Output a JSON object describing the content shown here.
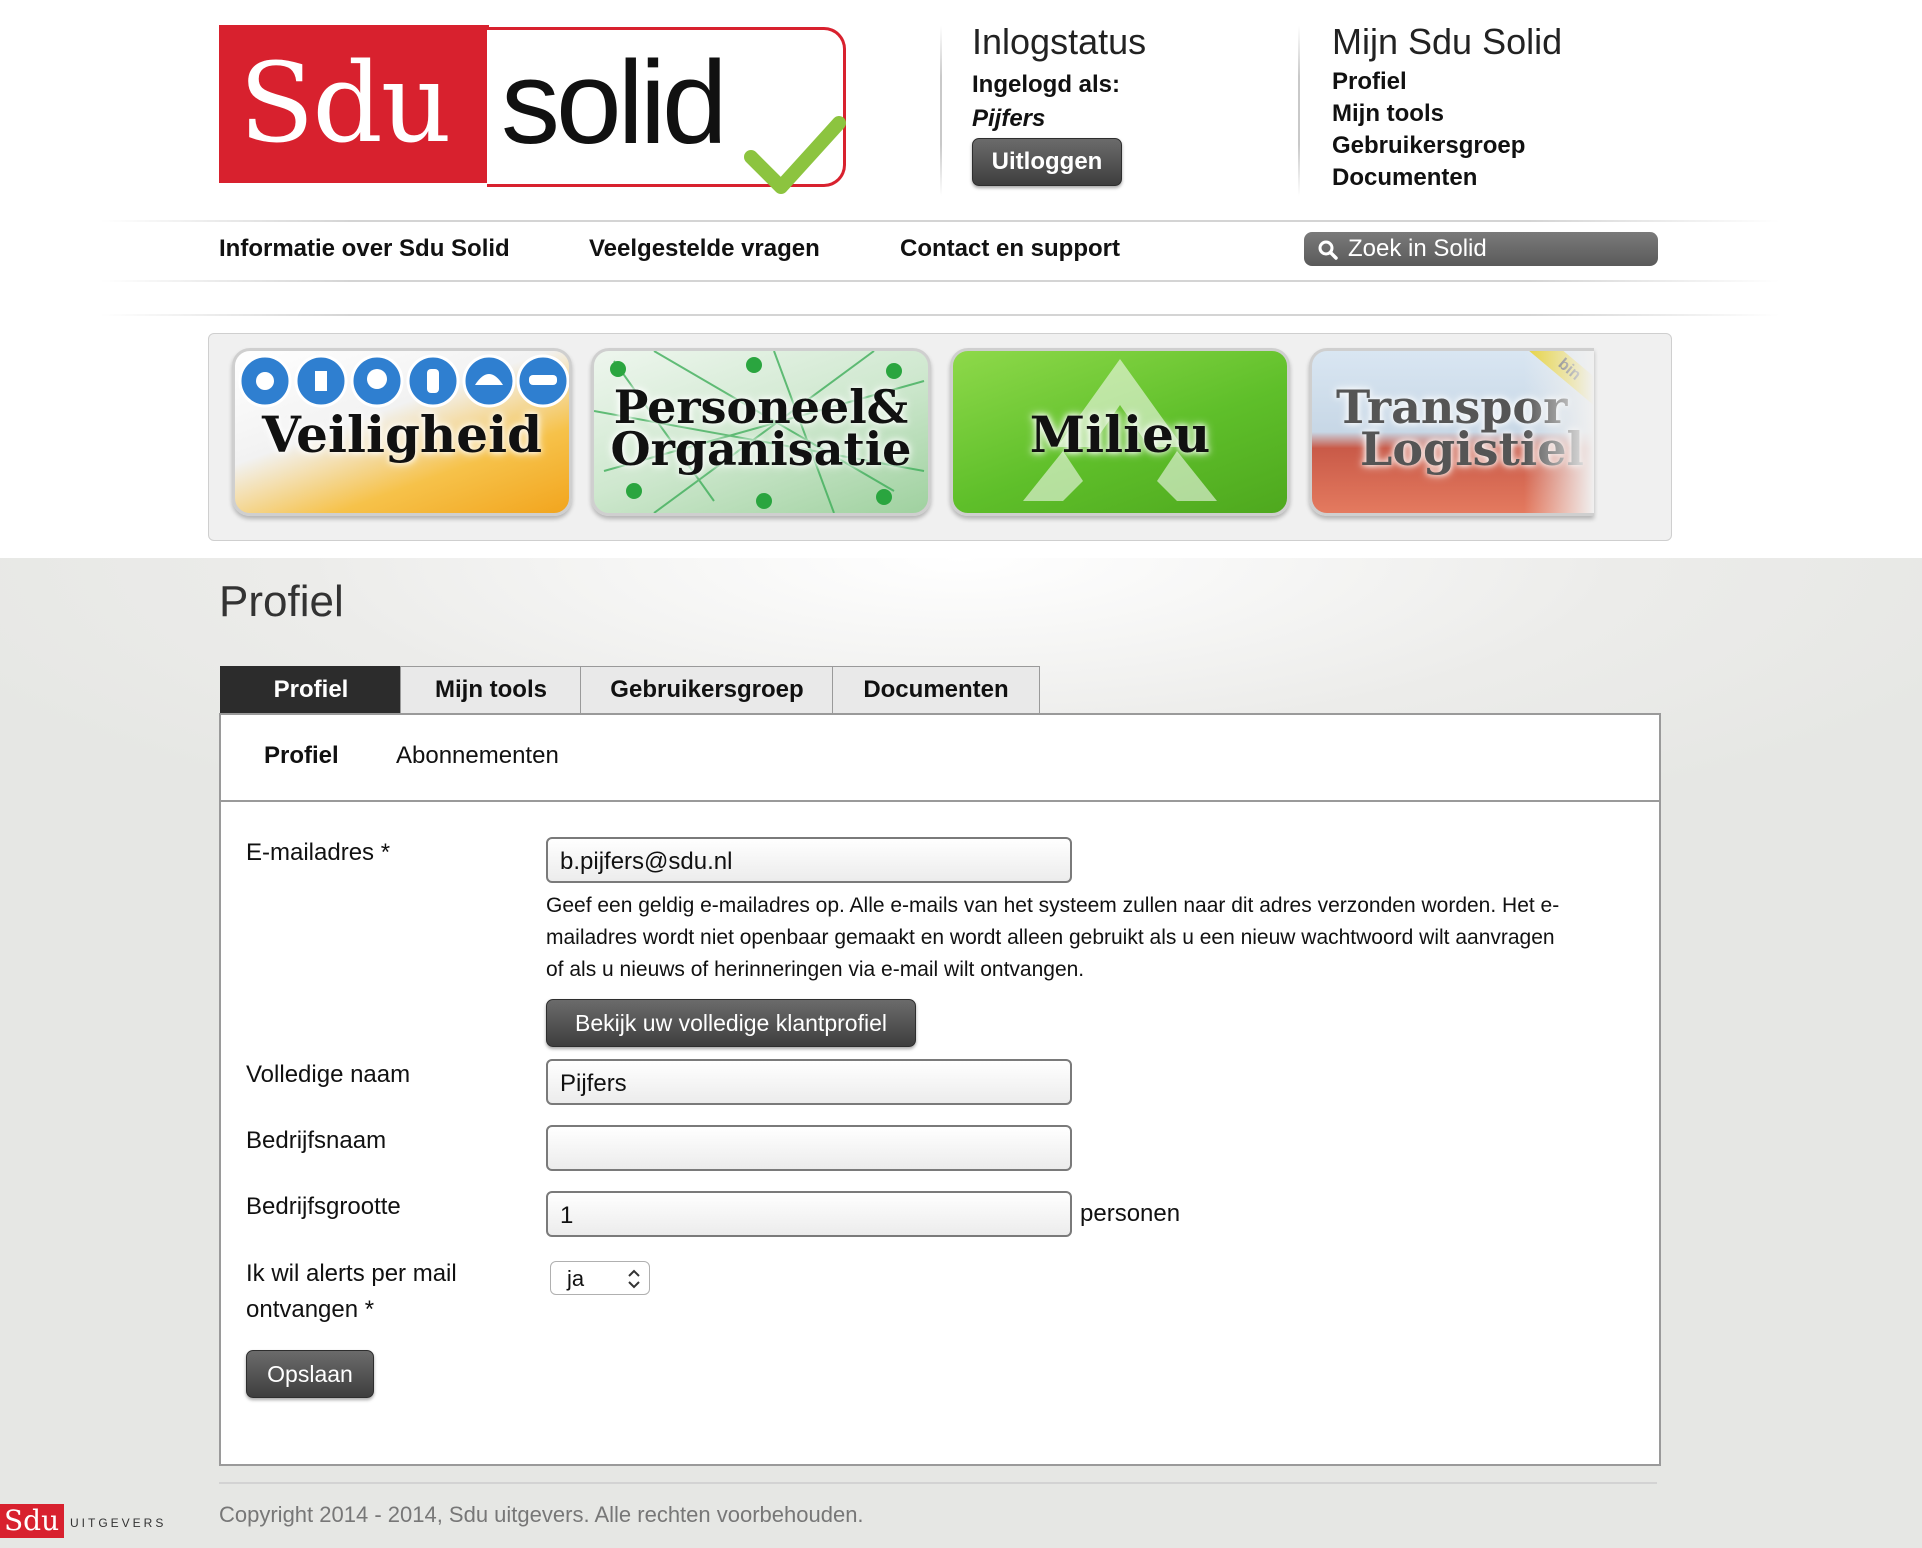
{
  "logo": {
    "part1": "Sdu",
    "part2": "solid"
  },
  "login": {
    "title": "Inlogstatus",
    "logged_in_as": "Ingelogd als:",
    "user": "Pijfers",
    "logout": "Uitloggen"
  },
  "mijn": {
    "title": "Mijn Sdu Solid",
    "links": [
      "Profiel",
      "Mijn tools",
      "Gebruikersgroep",
      "Documenten"
    ]
  },
  "nav": {
    "links": [
      "Informatie over Sdu Solid",
      "Veelgestelde vragen",
      "Contact en support"
    ],
    "search_label": "Zoek in Solid"
  },
  "tiles": [
    {
      "line1": "Veiligheid",
      "line2": ""
    },
    {
      "line1": "Personeel&",
      "line2": "Organisatie"
    },
    {
      "line1": "Milieu",
      "line2": ""
    },
    {
      "line1": "Transpor",
      "line2": "Logistiel",
      "badge": "bin"
    }
  ],
  "page_title": "Profiel",
  "tabs": [
    "Profiel",
    "Mijn tools",
    "Gebruikersgroep",
    "Documenten"
  ],
  "subtabs": [
    "Profiel",
    "Abonnementen"
  ],
  "form": {
    "email_label": "E-mailadres *",
    "email_value": "b.pijfers@sdu.nl",
    "email_help_lines": [
      "Geef een geldig e-mailadres op. Alle e-mails van het systeem zullen naar dit adres verzonden worden. Het e-",
      "mailadres wordt niet openbaar gemaakt en wordt alleen gebruikt als u een nieuw wachtwoord wilt aanvragen",
      "of als u nieuws of herinneringen via e-mail wilt ontvangen."
    ],
    "profile_button": "Bekijk uw volledige klantprofiel",
    "name_label": "Volledige naam",
    "name_value": "Pijfers",
    "company_label": "Bedrijfsnaam",
    "company_value": "",
    "size_label": "Bedrijfsgrootte",
    "size_value": "1",
    "size_suffix": "personen",
    "alerts_label_1": "Ik wil alerts per mail",
    "alerts_label_2": "ontvangen *",
    "alerts_value": "ja",
    "save": "Opslaan"
  },
  "footer": {
    "copyright": "Copyright 2014 - 2014, Sdu uitgevers. Alle rechten voorbehouden.",
    "brand": "Sdu",
    "brand_sub": "UITGEVERS"
  },
  "colors": {
    "brand_red": "#d8212e",
    "check_green": "#8cc43f",
    "dark_button": "#444444"
  }
}
